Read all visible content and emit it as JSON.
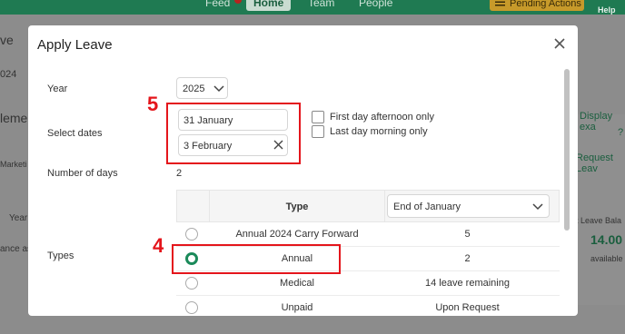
{
  "top_nav": {
    "items": [
      "Feed",
      "Home",
      "Team",
      "People"
    ],
    "pending_label": "Pending Actions",
    "help_label": "Help Ce"
  },
  "background": {
    "fragments": {
      "ve": "ve",
      "num024": "024",
      "leme": "leme",
      "marketi": "Marketi",
      "year": "Year",
      "ance_as": "ance as",
      "display_exa": "Display exa",
      "request_leave": "Request Leav",
      "balance_header": "ent Leave Bala",
      "balance_value": "14.00",
      "available": "available"
    }
  },
  "modal": {
    "title": "Apply Leave",
    "year_label": "Year",
    "year_value": "2025",
    "select_dates_label": "Select dates",
    "start_date": "31 January",
    "end_date": "3 February",
    "first_day_option": "First day afternoon only",
    "last_day_option": "Last day morning only",
    "number_of_days_label": "Number of days",
    "number_of_days_value": "2",
    "types_label": "Types",
    "table": {
      "type_header": "Type",
      "period_select_value": "End of January",
      "rows": [
        {
          "type": "Annual 2024 Carry Forward",
          "balance": "5",
          "selected": false
        },
        {
          "type": "Annual",
          "balance": "2",
          "selected": true
        },
        {
          "type": "Medical",
          "balance": "14 leave remaining",
          "selected": false
        },
        {
          "type": "Unpaid",
          "balance": "Upon Request",
          "selected": false
        }
      ]
    }
  },
  "annotations": {
    "step_dates": "5",
    "step_type": "4",
    "color": "#e4151b"
  },
  "colors": {
    "brand_green": "#1f7a52",
    "radio_selected": "#1b8a5a",
    "pending_bg": "#c79a2a"
  }
}
